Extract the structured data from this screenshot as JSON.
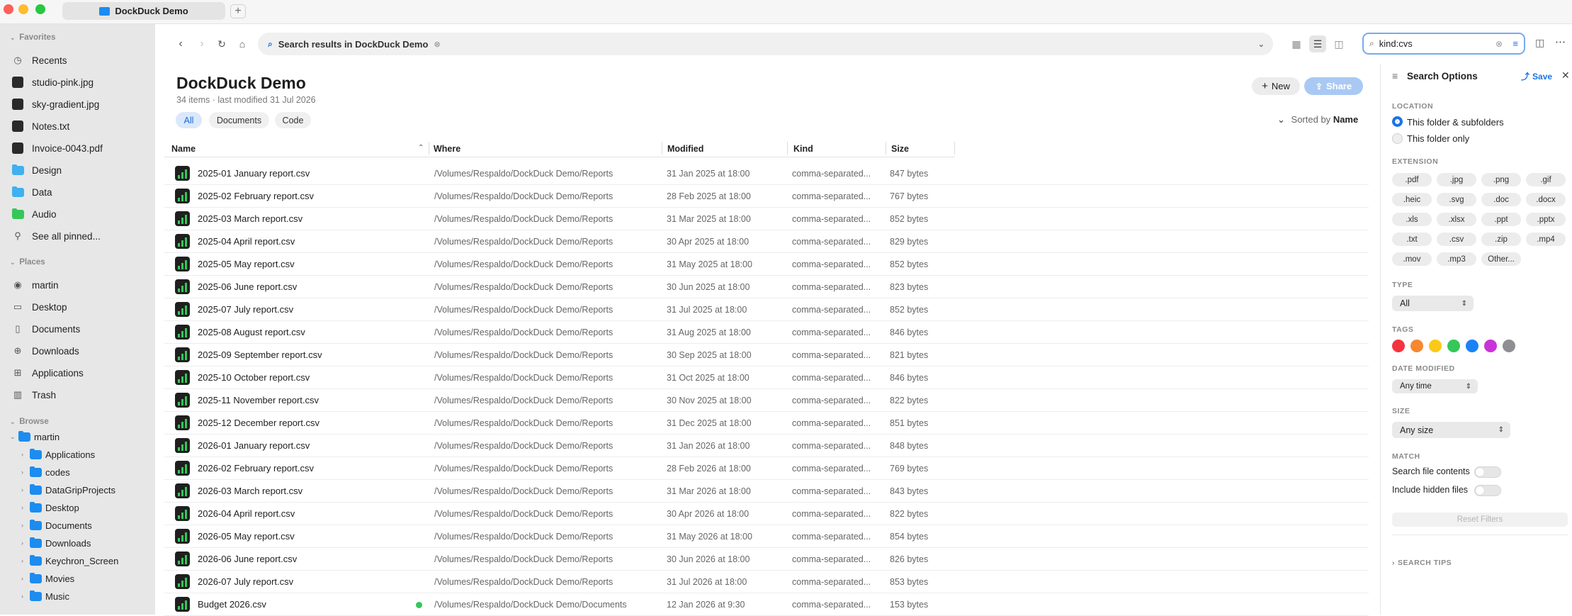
{
  "window": {
    "tab_title": "DockDuck Demo",
    "new_tab": "+"
  },
  "sidebar": {
    "favorites_header": "Favorites",
    "favorites": [
      {
        "label": "Recents",
        "icon": "clock-icon"
      },
      {
        "label": "studio-pink.jpg",
        "icon": "image-thumb-icon"
      },
      {
        "label": "sky-gradient.jpg",
        "icon": "image-thumb-icon"
      },
      {
        "label": "Notes.txt",
        "icon": "text-file-icon"
      },
      {
        "label": "Invoice-0043.pdf",
        "icon": "pdf-file-icon"
      },
      {
        "label": "Design",
        "icon": "folder-icon",
        "color": "#3fb0f0"
      },
      {
        "label": "Data",
        "icon": "folder-icon",
        "color": "#3fb0f0"
      },
      {
        "label": "Audio",
        "icon": "folder-icon",
        "color": "#35c759"
      },
      {
        "label": "See all pinned...",
        "icon": "pin-icon"
      }
    ],
    "places_header": "Places",
    "places": [
      {
        "label": "martin",
        "icon": "person-icon"
      },
      {
        "label": "Desktop",
        "icon": "desktop-icon"
      },
      {
        "label": "Documents",
        "icon": "document-icon"
      },
      {
        "label": "Downloads",
        "icon": "download-icon"
      },
      {
        "label": "Applications",
        "icon": "applications-icon"
      },
      {
        "label": "Trash",
        "icon": "trash-icon"
      }
    ],
    "browse_header": "Browse",
    "browse_root": "martin",
    "browse_children": [
      "Applications",
      "codes",
      "DataGripProjects",
      "Desktop",
      "Documents",
      "Downloads",
      "Keychron_Screen",
      "Movies",
      "Music"
    ]
  },
  "toolbar": {
    "path_label": "Search results in DockDuck Demo",
    "search_value": "kind:cvs"
  },
  "header": {
    "title": "DockDuck Demo",
    "subtitle": "34 items · last modified 31 Jul 2026",
    "new_label": "New",
    "share_label": "Share",
    "filters": [
      "All",
      "Documents",
      "Code"
    ],
    "sorted_by_label": "Sorted by",
    "sorted_by_value": "Name"
  },
  "table": {
    "columns": [
      "Name",
      "Where",
      "Modified",
      "Kind",
      "Size"
    ],
    "rows": [
      {
        "name": "2025-01 January report.csv",
        "where": "/Volumes/Respaldo/DockDuck Demo/Reports",
        "modified": "31 Jan 2025 at 18:00",
        "kind": "comma-separated...",
        "size": "847 bytes"
      },
      {
        "name": "2025-02 February report.csv",
        "where": "/Volumes/Respaldo/DockDuck Demo/Reports",
        "modified": "28 Feb 2025 at 18:00",
        "kind": "comma-separated...",
        "size": "767 bytes"
      },
      {
        "name": "2025-03 March report.csv",
        "where": "/Volumes/Respaldo/DockDuck Demo/Reports",
        "modified": "31 Mar 2025 at 18:00",
        "kind": "comma-separated...",
        "size": "852 bytes"
      },
      {
        "name": "2025-04 April report.csv",
        "where": "/Volumes/Respaldo/DockDuck Demo/Reports",
        "modified": "30 Apr 2025 at 18:00",
        "kind": "comma-separated...",
        "size": "829 bytes"
      },
      {
        "name": "2025-05 May report.csv",
        "where": "/Volumes/Respaldo/DockDuck Demo/Reports",
        "modified": "31 May 2025 at 18:00",
        "kind": "comma-separated...",
        "size": "852 bytes"
      },
      {
        "name": "2025-06 June report.csv",
        "where": "/Volumes/Respaldo/DockDuck Demo/Reports",
        "modified": "30 Jun 2025 at 18:00",
        "kind": "comma-separated...",
        "size": "823 bytes"
      },
      {
        "name": "2025-07 July report.csv",
        "where": "/Volumes/Respaldo/DockDuck Demo/Reports",
        "modified": "31 Jul 2025 at 18:00",
        "kind": "comma-separated...",
        "size": "852 bytes"
      },
      {
        "name": "2025-08 August report.csv",
        "where": "/Volumes/Respaldo/DockDuck Demo/Reports",
        "modified": "31 Aug 2025 at 18:00",
        "kind": "comma-separated...",
        "size": "846 bytes"
      },
      {
        "name": "2025-09 September report.csv",
        "where": "/Volumes/Respaldo/DockDuck Demo/Reports",
        "modified": "30 Sep 2025 at 18:00",
        "kind": "comma-separated...",
        "size": "821 bytes"
      },
      {
        "name": "2025-10 October report.csv",
        "where": "/Volumes/Respaldo/DockDuck Demo/Reports",
        "modified": "31 Oct 2025 at 18:00",
        "kind": "comma-separated...",
        "size": "846 bytes"
      },
      {
        "name": "2025-11 November report.csv",
        "where": "/Volumes/Respaldo/DockDuck Demo/Reports",
        "modified": "30 Nov 2025 at 18:00",
        "kind": "comma-separated...",
        "size": "822 bytes"
      },
      {
        "name": "2025-12 December report.csv",
        "where": "/Volumes/Respaldo/DockDuck Demo/Reports",
        "modified": "31 Dec 2025 at 18:00",
        "kind": "comma-separated...",
        "size": "851 bytes"
      },
      {
        "name": "2026-01 January report.csv",
        "where": "/Volumes/Respaldo/DockDuck Demo/Reports",
        "modified": "31 Jan 2026 at 18:00",
        "kind": "comma-separated...",
        "size": "848 bytes"
      },
      {
        "name": "2026-02 February report.csv",
        "where": "/Volumes/Respaldo/DockDuck Demo/Reports",
        "modified": "28 Feb 2026 at 18:00",
        "kind": "comma-separated...",
        "size": "769 bytes"
      },
      {
        "name": "2026-03 March report.csv",
        "where": "/Volumes/Respaldo/DockDuck Demo/Reports",
        "modified": "31 Mar 2026 at 18:00",
        "kind": "comma-separated...",
        "size": "843 bytes"
      },
      {
        "name": "2026-04 April report.csv",
        "where": "/Volumes/Respaldo/DockDuck Demo/Reports",
        "modified": "30 Apr 2026 at 18:00",
        "kind": "comma-separated...",
        "size": "822 bytes"
      },
      {
        "name": "2026-05 May report.csv",
        "where": "/Volumes/Respaldo/DockDuck Demo/Reports",
        "modified": "31 May 2026 at 18:00",
        "kind": "comma-separated...",
        "size": "854 bytes"
      },
      {
        "name": "2026-06 June report.csv",
        "where": "/Volumes/Respaldo/DockDuck Demo/Reports",
        "modified": "30 Jun 2026 at 18:00",
        "kind": "comma-separated...",
        "size": "826 bytes"
      },
      {
        "name": "2026-07 July report.csv",
        "where": "/Volumes/Respaldo/DockDuck Demo/Reports",
        "modified": "31 Jul 2026 at 18:00",
        "kind": "comma-separated...",
        "size": "853 bytes"
      },
      {
        "name": "Budget 2026.csv",
        "where": "/Volumes/Respaldo/DockDuck Demo/Documents",
        "modified": "12 Jan 2026 at 9:30",
        "kind": "comma-separated...",
        "size": "153 bytes",
        "tag": "#34c759"
      }
    ]
  },
  "search_options": {
    "title": "Search Options",
    "save_label": "Save",
    "location_header": "LOCATION",
    "location_options": [
      "This folder & subfolders",
      "This folder only"
    ],
    "location_selected": "This folder & subfolders",
    "extension_header": "EXTENSION",
    "extensions": [
      ".pdf",
      ".jpg",
      ".png",
      ".gif",
      ".heic",
      ".svg",
      ".doc",
      ".docx",
      ".xls",
      ".xlsx",
      ".ppt",
      ".pptx",
      ".txt",
      ".csv",
      ".zip",
      ".mp4",
      ".mov",
      ".mp3",
      "Other..."
    ],
    "type_header": "TYPE",
    "type_value": "All",
    "tags_header": "TAGS",
    "tag_colors": [
      "#f5333f",
      "#f7882f",
      "#fbc918",
      "#35c759",
      "#1a82f7",
      "#c834d8",
      "#8e8e93"
    ],
    "date_header": "DATE MODIFIED",
    "date_value": "Any time",
    "size_header": "SIZE",
    "size_value": "Any size",
    "match_header": "MATCH",
    "match_contents_label": "Search file contents",
    "match_hidden_label": "Include hidden files",
    "reset_label": "Reset Filters",
    "tips_label": "SEARCH TIPS"
  }
}
